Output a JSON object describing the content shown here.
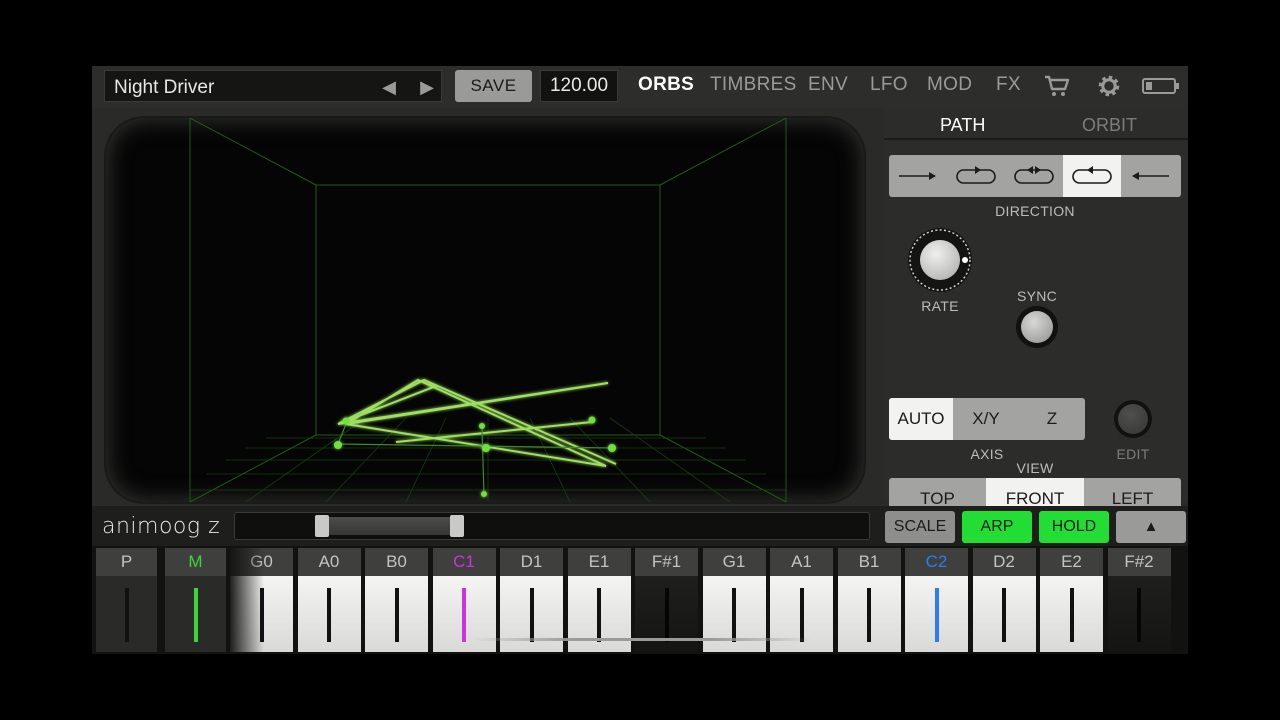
{
  "topbar": {
    "preset_name": "Night Driver",
    "prev_icon": "◀",
    "next_icon": "▶",
    "save_label": "SAVE",
    "bpm": "120.00",
    "tabs": [
      {
        "label": "ORBS",
        "active": true
      },
      {
        "label": "TIMBRES",
        "active": false
      },
      {
        "label": "ENV",
        "active": false
      },
      {
        "label": "LFO",
        "active": false
      },
      {
        "label": "MOD",
        "active": false
      },
      {
        "label": "FX",
        "active": false
      }
    ],
    "icons": [
      "cart-icon",
      "gear-icon",
      "battery-icon"
    ]
  },
  "panel": {
    "tabs": [
      {
        "label": "PATH",
        "active": true
      },
      {
        "label": "ORBIT",
        "active": false
      }
    ],
    "direction": {
      "label": "DIRECTION",
      "buttons": [
        {
          "icon": "arrow-right-icon",
          "active": false
        },
        {
          "icon": "loop-forward-icon",
          "active": false
        },
        {
          "icon": "loop-bidirectional-icon",
          "active": false
        },
        {
          "icon": "loop-reverse-icon",
          "active": true
        },
        {
          "icon": "arrow-left-icon",
          "active": false
        }
      ]
    },
    "rate_label": "RATE",
    "sync_label": "SYNC",
    "axis": {
      "label": "AXIS",
      "options": [
        {
          "label": "AUTO",
          "active": true
        },
        {
          "label": "X/Y",
          "active": false
        },
        {
          "label": "Z",
          "active": false
        }
      ]
    },
    "edit_label": "EDIT",
    "view": {
      "label": "VIEW",
      "options": [
        {
          "label": "TOP",
          "active": false
        },
        {
          "label": "FRONT",
          "active": true
        },
        {
          "label": "LEFT",
          "active": false
        }
      ]
    }
  },
  "strip": {
    "logo": "animoog z",
    "scale_label": "SCALE",
    "arp_label": "ARP",
    "hold_label": "HOLD",
    "expand_icon": "▲",
    "colors": {
      "green_on": "#22dd33",
      "button_gray": "#9a9b98"
    }
  },
  "keyboard": {
    "pitch_label": "P",
    "mod_label": "M",
    "keys": [
      {
        "label": "G0",
        "type": "white"
      },
      {
        "label": "A0",
        "type": "white"
      },
      {
        "label": "B0",
        "type": "white"
      },
      {
        "label": "C1",
        "type": "white",
        "accent": "#cc33dd"
      },
      {
        "label": "D1",
        "type": "white"
      },
      {
        "label": "E1",
        "type": "white"
      },
      {
        "label": "F#1",
        "type": "black"
      },
      {
        "label": "G1",
        "type": "white"
      },
      {
        "label": "A1",
        "type": "white"
      },
      {
        "label": "B1",
        "type": "white"
      },
      {
        "label": "C2",
        "type": "white",
        "accent": "#2a7cf0"
      },
      {
        "label": "D2",
        "type": "white"
      },
      {
        "label": "E2",
        "type": "white"
      },
      {
        "label": "F#2",
        "type": "black"
      }
    ],
    "colors": {
      "mod_green": "#3ed33a"
    }
  }
}
